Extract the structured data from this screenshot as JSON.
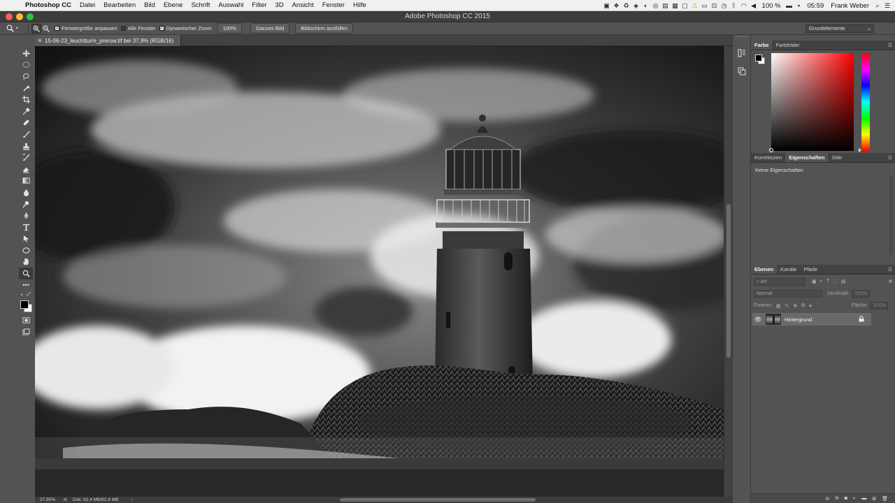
{
  "menubar": {
    "app": "Photoshop CC",
    "items": [
      "Datei",
      "Bearbeiten",
      "Bild",
      "Ebene",
      "Schrift",
      "Auswahl",
      "Filter",
      "3D",
      "Ansicht",
      "Fenster",
      "Hilfe"
    ],
    "battery": "100 %",
    "clock": "05:59",
    "user": "Frank Weber"
  },
  "window": {
    "title": "Adobe Photoshop CC 2015"
  },
  "options": {
    "check1": "Fenstergröße anpassen",
    "check2": "Alle Fenster",
    "check3": "Dynamischer Zoom",
    "btn100": "100%",
    "btn_fit": "Ganzes Bild",
    "btn_fill": "Bildschirm ausfüllen",
    "workspace": "Grundelemente"
  },
  "document": {
    "tab": "15-06-23_leuchtturm_prerow.tif bei 37,9% (RGB/16)",
    "zoom": "37,95%",
    "doc_size": "Dok: 62,4 MB/62,4 MB"
  },
  "panels": {
    "color_tabs": [
      "Farbe",
      "Farbfelder"
    ],
    "props_tabs": [
      "Korrekturen",
      "Eigenschaften",
      "Stile"
    ],
    "props_empty": "Keine Eigenschaften",
    "layers_tabs": [
      "Ebenen",
      "Kanäle",
      "Pfade"
    ],
    "filter_placeholder": "Art",
    "blend_mode": "Normal",
    "opacity_label": "Deckkraft:",
    "opacity_value": "100%",
    "lock_label": "Fixieren:",
    "fill_label": "Fläche:",
    "fill_value": "100%",
    "layer_name": "Hintergrund"
  },
  "colors": {
    "fg": "#000000",
    "bg": "#ffffff",
    "picker_hue": "#ff0000"
  }
}
